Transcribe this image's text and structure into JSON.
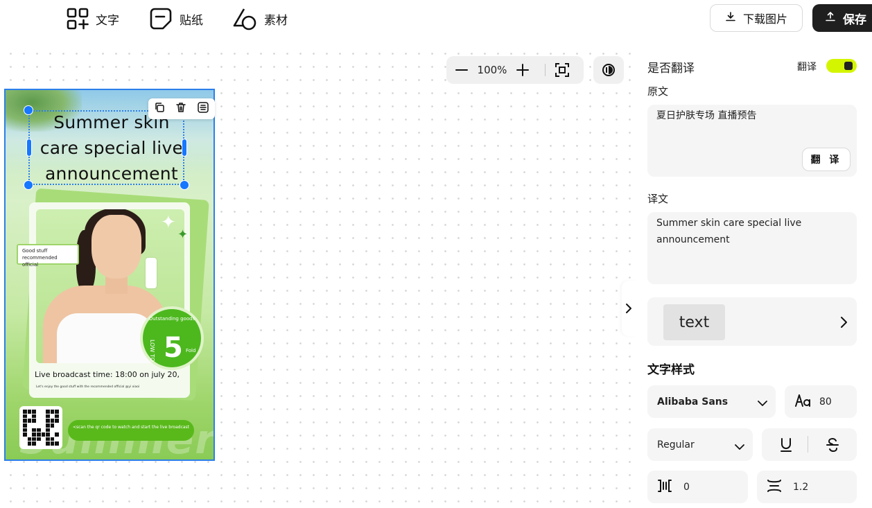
{
  "toolbar": {
    "text_tool": "文字",
    "sticker_tool": "贴纸",
    "material_tool": "素材",
    "download_label": "下载图片",
    "save_label": "保存"
  },
  "canvas": {
    "zoom": "100%"
  },
  "poster": {
    "title": "Summer skin care special live announcement",
    "tag": "Good stuff recommended official",
    "badge_top": "Outstanding goods",
    "badge_side": "LOW TO",
    "badge_number": "5",
    "badge_suffix": "Fold",
    "live_time": "Live broadcast time: 18:00 on july 20,",
    "small_text": "Let's enjoy the good stuff with the recommended official @yi xiaoi",
    "scan_button": "<scan the qr code to watch and start the live broadcast",
    "watermark": "Summer"
  },
  "panel": {
    "translate_question": "是否翻译",
    "translate_toggle_label": "翻译",
    "translate_enabled": true,
    "original_label": "原文",
    "original_text": "夏日护肤专场 直播预告",
    "translate_button": "翻 译",
    "translation_label": "译文",
    "translation_text": "Summer skin care special live announcement",
    "preset_text": "text",
    "text_style_title": "文字样式",
    "font_family": "Alibaba Sans",
    "font_size": "80",
    "font_weight": "Regular",
    "letter_spacing": "0",
    "line_height": "1.2"
  },
  "colors": {
    "accent_blue": "#2b7fea",
    "toggle_on": "#d4f500",
    "save_button_bg": "#1f1f1f"
  },
  "icons": {
    "text_tool": "text-add-icon",
    "sticker_tool": "sticker-icon",
    "material_tool": "shapes-icon",
    "download": "download-icon",
    "save": "upload-icon"
  }
}
